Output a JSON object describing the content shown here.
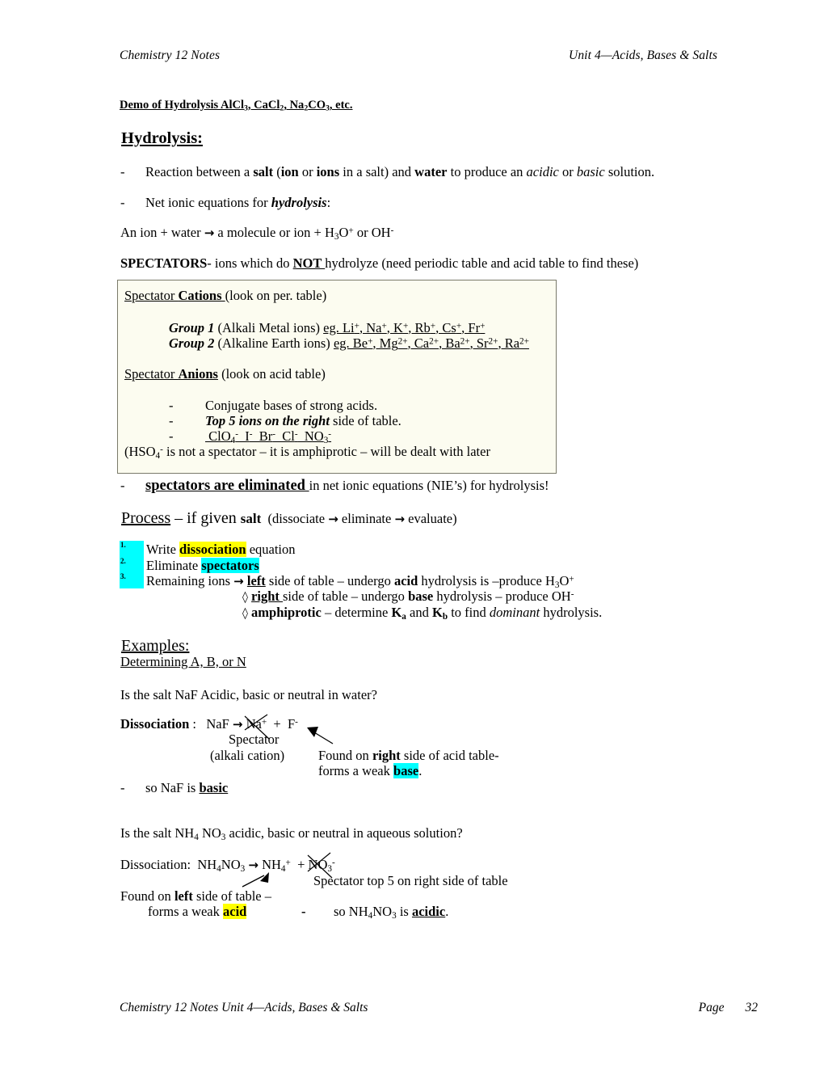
{
  "header": {
    "left": "Chemistry 12 Notes",
    "right": "Unit 4—Acids, Bases & Salts"
  },
  "footer": {
    "left": "Chemistry 12 Notes  Unit 4—Acids, Bases & Salts",
    "page_label": "Page",
    "page_number": "32"
  },
  "colors": {
    "highlight_yellow": "#ffff00",
    "highlight_cyan": "#00ffff",
    "box_background": "#fcfcf0",
    "box_border": "#7a7a6a",
    "text": "#000000"
  },
  "demo_heading": {
    "prefix": "Demo of Hydrolysis AlCl",
    "sub1": "3",
    "mid1": ", CaCl",
    "sub2": "2",
    "mid2": ", Na",
    "sub3": "2",
    "mid3": "CO",
    "sub4": "3",
    "suffix": ", etc."
  },
  "section_title": "Hydrolysis:",
  "bullets": [
    {
      "dash": "-",
      "parts": [
        {
          "t": "Reaction between a ",
          "s": "n"
        },
        {
          "t": "salt",
          "s": "b"
        },
        {
          "t": " (",
          "s": "n"
        },
        {
          "t": "ion",
          "s": "b"
        },
        {
          "t": " or ",
          "s": "n"
        },
        {
          "t": "ions",
          "s": "b"
        },
        {
          "t": " in a salt) and ",
          "s": "n"
        },
        {
          "t": "water",
          "s": "b"
        },
        {
          "t": " to produce an ",
          "s": "n"
        },
        {
          "t": "acidic",
          "s": "i"
        },
        {
          "t": " or ",
          "s": "n"
        },
        {
          "t": "basic",
          "s": "i"
        },
        {
          "t": " solution.",
          "s": "n"
        }
      ]
    },
    {
      "dash": "-",
      "parts": [
        {
          "t": "Net ionic equations for ",
          "s": "n"
        },
        {
          "t": "hydrolysis",
          "s": "bi"
        },
        {
          "t": ":",
          "s": "n"
        }
      ]
    }
  ],
  "net_ionic_line": {
    "pre": "An ion + water ",
    "arrow": "→",
    "mid": " a molecule or ion + H",
    "sub_3": "3",
    "o": "O",
    "sup_plus": "+",
    "tail": " or OH",
    "sup_minus": "-"
  },
  "spectators_line": {
    "bold": "SPECTATORS",
    "mid1": "- ions which do ",
    "not": "NOT",
    "mid2": " hydrolyze (need periodic table and acid table to find these)"
  },
  "spectator_box": {
    "cations_heading_1": "Spectator ",
    "cations_heading_2": "Cations",
    "cations_heading_3": " (look on per. table)",
    "group1": {
      "label": "Group 1",
      "desc": " (Alkali Metal ions) ",
      "eg": "eg. Li",
      "ions": "Li+, Na+, K+, Rb+, Cs+, Fr+"
    },
    "group2": {
      "label": "Group 2",
      "desc": " (Alkaline Earth ions) ",
      "ions": "Be+, Mg2+, Ca2+, Ba2+, Sr2+, Ra2+"
    },
    "anions_heading_1": "Spectator ",
    "anions_heading_2": "Anions",
    "anions_heading_3": " (look on acid table)",
    "anion_items": [
      {
        "dash": "-",
        "text": "Conjugate bases of strong acids.",
        "style": "n"
      },
      {
        "dash": "-",
        "bold_italic": "Top 5 ions on the right",
        "rest": " side of table.",
        "style": "bi"
      },
      {
        "dash": "-",
        "formula": "ClO4- I- Br- Cl- NO3-",
        "style": "u"
      }
    ],
    "note": "(HSO4- is not a spectator – it is amphiprotic – will be dealt with later"
  },
  "eliminated_bullet": {
    "dash": "-",
    "bold_underline": "spectators are eliminated",
    "rest": " in net ionic equations (NIE’s) for hydrolysis!"
  },
  "process": {
    "word": "Process",
    "mid": " – if given ",
    "salt": "salt",
    "paren": "  (dissociate → eliminate → evaluate)"
  },
  "steps": [
    {
      "num": "1.",
      "parts": [
        {
          "t": "Write ",
          "s": "n"
        },
        {
          "t": "dissociation",
          "s": "b-hl-y"
        },
        {
          "t": " equation",
          "s": "n"
        }
      ]
    },
    {
      "num": "2.",
      "parts": [
        {
          "t": "Eliminate ",
          "s": "n"
        },
        {
          "t": "spectators",
          "s": "b-hl-c"
        }
      ]
    },
    {
      "num": "3.",
      "parts": [
        {
          "t": "Remaining ions ",
          "s": "n"
        },
        {
          "t": "→",
          "s": "arrow"
        },
        {
          "t": " ",
          "s": "n"
        },
        {
          "t": "left",
          "s": "bu"
        },
        {
          "t": " side of table – undergo ",
          "s": "n"
        },
        {
          "t": "acid",
          "s": "b"
        },
        {
          "t": " hydrolysis is –produce H",
          "s": "n"
        },
        {
          "t": "3",
          "s": "sub"
        },
        {
          "t": "O",
          "s": "n"
        },
        {
          "t": "+",
          "s": "sup"
        }
      ]
    }
  ],
  "sub_steps": [
    {
      "diamond": "◊",
      "parts": [
        {
          "t": "right",
          "s": "bu"
        },
        {
          "t": " side of table – undergo ",
          "s": "n"
        },
        {
          "t": "base",
          "s": "b"
        },
        {
          "t": " hydrolysis – produce OH",
          "s": "n"
        },
        {
          "t": "-",
          "s": "sup"
        }
      ]
    },
    {
      "diamond": "◊",
      "parts": [
        {
          "t": "amphiprotic",
          "s": "b"
        },
        {
          "t": " – determine K",
          "s": "n"
        },
        {
          "t": "a",
          "s": "b-sub"
        },
        {
          "t": " and K",
          "s": "n"
        },
        {
          "t": "b",
          "s": "b-sub"
        },
        {
          "t": " to find ",
          "s": "n"
        },
        {
          "t": "dominant",
          "s": "i"
        },
        {
          "t": " hydrolysis.",
          "s": "n"
        }
      ]
    }
  ],
  "examples": {
    "title": "Examples:",
    "subtitle": "Determining A, B, or N",
    "q1": "Is the salt NaF Acidic, basic or neutral in water?",
    "ex1": {
      "label": "Dissociation",
      "colon": " :   NaF ",
      "arrow": "→",
      "products": " Na+  +  F-",
      "annot_spectator": "Spectator",
      "annot_alkali": "(alkali cation)",
      "found_pre": "Found  on ",
      "found_bold": "right",
      "found_post": " side of acid table-",
      "forms_pre": "forms a weak ",
      "forms_hl": "base",
      "forms_post": ".",
      "conclusion_dash": "-",
      "conclusion_pre": "so NaF is ",
      "conclusion_bu": "basic"
    },
    "q2": "Is the salt NH4 NO3 acidic, basic or neutral in aqueous solution?",
    "ex2": {
      "label": "Dissociation:",
      "reaction_pre": "  NH4NO3 ",
      "arrow": "→",
      "reaction_post": " NH4+  + NO3-",
      "spectator_note": "Spectator top 5 on right side of table",
      "found_pre": "Found on ",
      "found_bold": "left",
      "found_post": " side of table –",
      "forms_pre": "forms a weak ",
      "forms_hl": "acid",
      "conc_dash": "-",
      "conc_pre": "so NH4NO3 is ",
      "conc_bu": "acidic",
      "conc_post": "."
    }
  }
}
